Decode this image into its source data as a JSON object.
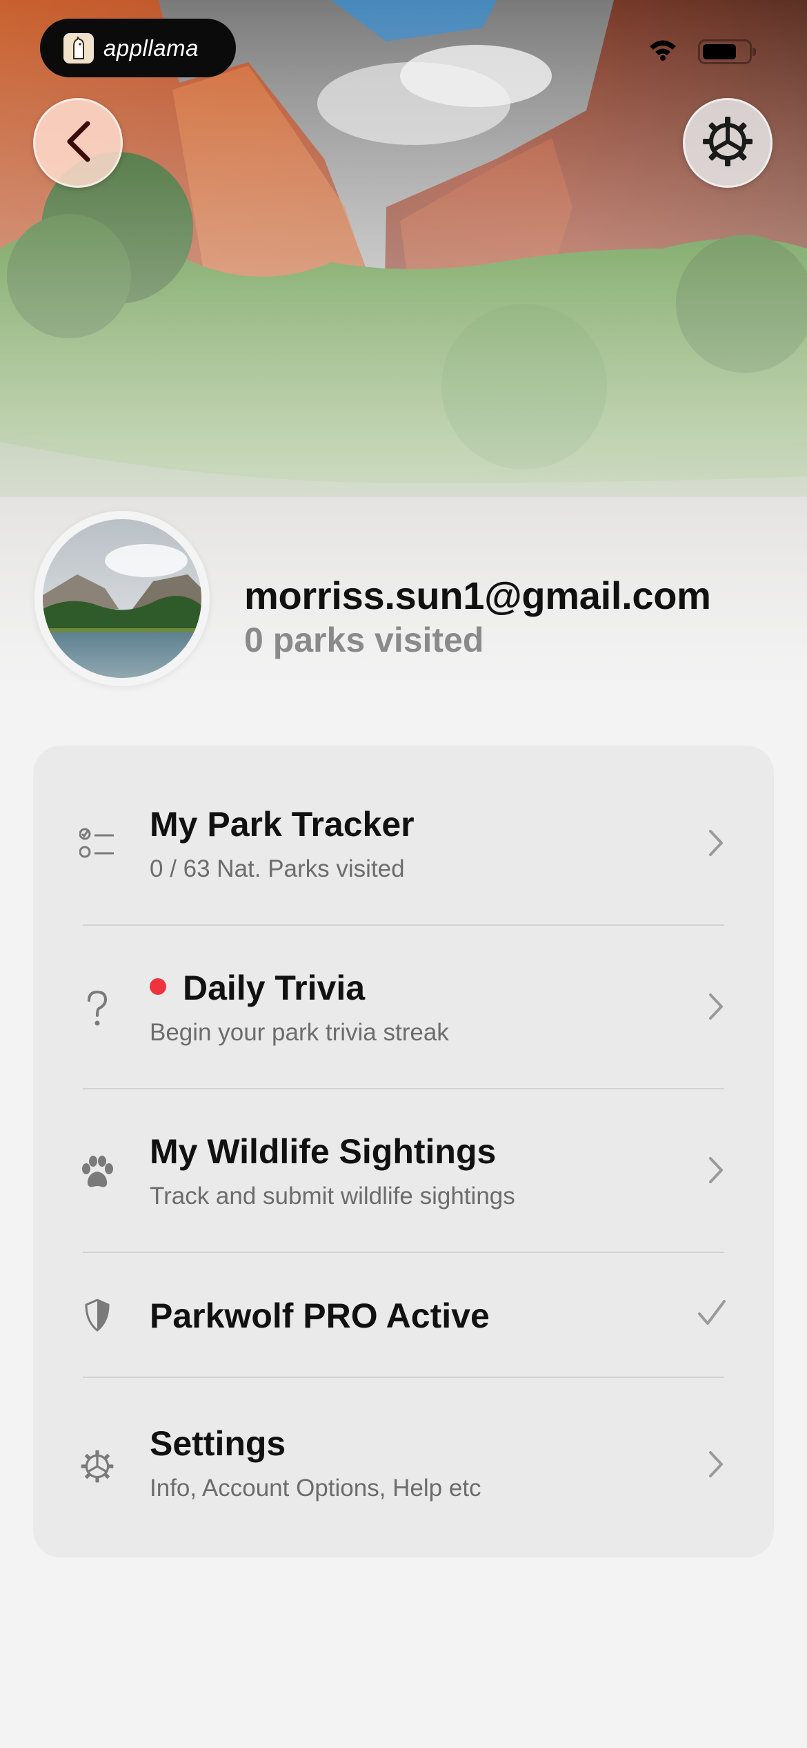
{
  "status_bar": {
    "brand_label": "appllama",
    "wifi_icon": "wifi-icon",
    "battery_icon": "battery-icon"
  },
  "header": {
    "back_icon": "chevron-left-icon",
    "settings_icon": "gear-icon"
  },
  "profile": {
    "email": "morriss.sun1@gmail.com",
    "parks_visited": "0 parks visited"
  },
  "menu": {
    "items": [
      {
        "icon": "checklist-icon",
        "title": "My Park Tracker",
        "subtitle": "0 / 63 Nat. Parks visited",
        "trailing": "chevron-right-icon"
      },
      {
        "icon": "question-mark-icon",
        "title": "Daily Trivia",
        "subtitle": "Begin your park trivia streak",
        "trailing": "chevron-right-icon",
        "badge": "red-dot"
      },
      {
        "icon": "paw-icon",
        "title": "My Wildlife Sightings",
        "subtitle": "Track and submit wildlife sightings",
        "trailing": "chevron-right-icon"
      },
      {
        "icon": "shield-icon",
        "title": "Parkwolf PRO Active",
        "trailing": "checkmark-icon"
      },
      {
        "icon": "gear-icon",
        "title": "Settings",
        "subtitle": "Info, Account Options, Help etc",
        "trailing": "chevron-right-icon"
      }
    ]
  },
  "colors": {
    "background": "#f3f3f3",
    "card": "#eaeaea",
    "notification_dot": "#f0323f",
    "secondary_text": "#8a8a8a"
  }
}
